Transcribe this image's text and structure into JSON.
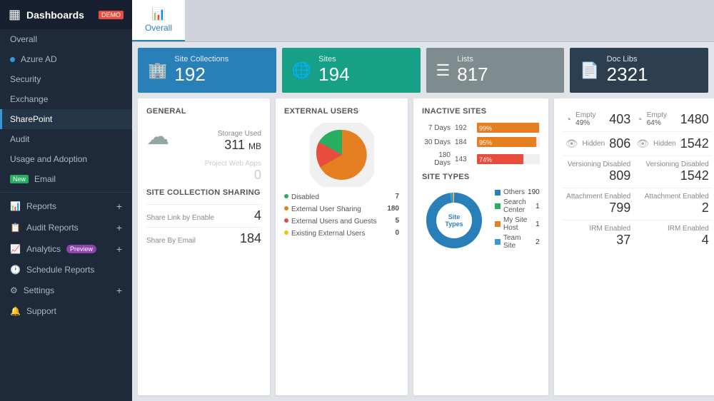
{
  "sidebar": {
    "title": "Dashboards",
    "demo_badge": "DEMO",
    "items": [
      {
        "id": "overall",
        "label": "Overall",
        "indent": true
      },
      {
        "id": "azure-ad",
        "label": "Azure AD",
        "dot": true
      },
      {
        "id": "security",
        "label": "Security"
      },
      {
        "id": "exchange",
        "label": "Exchange"
      },
      {
        "id": "sharepoint",
        "label": "SharePoint",
        "active": true
      },
      {
        "id": "audit",
        "label": "Audit"
      },
      {
        "id": "usage",
        "label": "Usage and Adoption"
      },
      {
        "id": "email",
        "label": "Email",
        "new": true
      }
    ],
    "sections": [
      {
        "id": "reports",
        "label": "Reports",
        "icon": "📊",
        "plus": true
      },
      {
        "id": "audit-reports",
        "label": "Audit Reports",
        "icon": "📋",
        "plus": true
      },
      {
        "id": "analytics",
        "label": "Analytics",
        "icon": "📈",
        "plus": true,
        "preview": true
      },
      {
        "id": "schedule-reports",
        "label": "Schedule Reports",
        "icon": "🕐"
      },
      {
        "id": "settings",
        "label": "Settings",
        "icon": "⚙",
        "plus": true
      },
      {
        "id": "support",
        "label": "Support",
        "icon": "🔔"
      }
    ]
  },
  "tabs": [
    {
      "id": "overall",
      "label": "Overall",
      "icon": "📊",
      "active": true
    }
  ],
  "stat_cards": [
    {
      "id": "site-collections",
      "icon": "🏢",
      "label": "Site Collections",
      "value": "192"
    },
    {
      "id": "sites",
      "icon": "🌐",
      "label": "Sites",
      "value": "194"
    },
    {
      "id": "lists",
      "icon": "☰",
      "label": "Lists",
      "value": "817"
    },
    {
      "id": "doc-libs",
      "icon": "📄",
      "label": "Doc Libs",
      "value": "2321"
    }
  ],
  "general": {
    "title": "General",
    "storage_label": "Storage Used",
    "storage_value": "311",
    "storage_unit": "MB",
    "project_label": "Project Web Apps",
    "project_value": "0"
  },
  "site_collection_sharing": {
    "title": "Site Collection Sharing",
    "share_link_label": "Share Link by Enable",
    "share_link_value": "4",
    "share_email_label": "Share By Email",
    "share_email_value": "184"
  },
  "inactive_sites": {
    "title": "Inactive Sites",
    "bars": [
      {
        "label": "7 Days",
        "count": "192",
        "pct": 99,
        "color": "#e67e22"
      },
      {
        "label": "30 Days",
        "count": "184",
        "pct": 95,
        "color": "#e67e22"
      },
      {
        "label": "180 Days",
        "count": "143",
        "pct": 74,
        "color": "#e74c3c"
      }
    ]
  },
  "site_types": {
    "title": "Site Types",
    "center_label": "Site Types",
    "legend": [
      {
        "label": "Others",
        "value": "190",
        "color": "#2980b9"
      },
      {
        "label": "Search Center",
        "value": "1",
        "color": "#27ae60"
      },
      {
        "label": "My Site Host",
        "value": "1",
        "color": "#e67e22"
      },
      {
        "label": "Team Site",
        "value": "2",
        "color": "#3498db"
      }
    ]
  },
  "lists_stats": {
    "title": "",
    "stats": [
      {
        "label": "Empty",
        "value": "403",
        "icon": "pie"
      },
      {
        "label": "Empty",
        "value": "1480",
        "icon": "pie"
      },
      {
        "label": "Hidden",
        "value": "806",
        "icon": "eye"
      },
      {
        "label": "Hidden",
        "value": "1542",
        "icon": "eye"
      },
      {
        "label": "Versioning Disabled",
        "value": "809"
      },
      {
        "label": "Versioning Disabled",
        "value": "1542"
      },
      {
        "label": "Attachment Enabled",
        "value": "799"
      },
      {
        "label": "Attachment Enabled",
        "value": "2"
      },
      {
        "label": "IRM Enabled",
        "value": "37"
      },
      {
        "label": "IRM Enabled",
        "value": "4"
      }
    ],
    "pie1_pct": 49,
    "pie2_pct": 64
  },
  "external_users": {
    "title": "External Users",
    "legend": [
      {
        "label": "Disabled",
        "value": "7",
        "color": "#27ae60"
      },
      {
        "label": "External User Sharing",
        "value": "180",
        "color": "#e67e22"
      },
      {
        "label": "External Users and Guests",
        "value": "5",
        "color": "#e74c3c"
      },
      {
        "label": "Existing External Users",
        "value": "0",
        "color": "#f1c40f"
      }
    ]
  }
}
